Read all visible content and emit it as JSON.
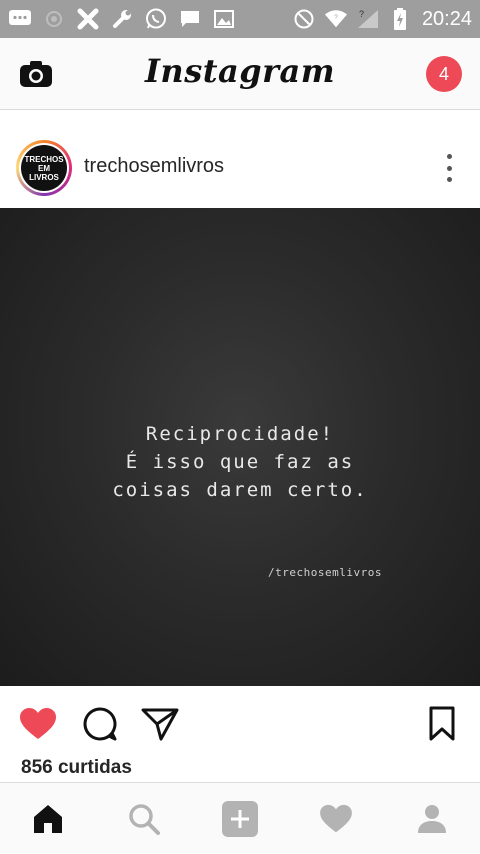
{
  "status_bar": {
    "time": "20:24",
    "icons": [
      "message-icon",
      "circle-icon",
      "puzzle-icon",
      "wrench-icon",
      "whatsapp-icon",
      "chat-icon",
      "image-icon",
      "no-disturb-icon",
      "wifi-icon",
      "signal-icon",
      "battery-icon"
    ]
  },
  "top_bar": {
    "logo": "Instagram",
    "notification_count": "4",
    "camera_icon": "camera-icon"
  },
  "post": {
    "username": "trechosemlivros",
    "avatar_text": [
      "TRECHOS",
      "EM",
      "LIVROS"
    ],
    "image_quote": [
      "Reciprocidade!",
      "É isso que faz as",
      "coisas darem certo."
    ],
    "image_watermark": "/trechosemlivros",
    "likes": "856 curtidas"
  },
  "colors": {
    "accent_red": "#ed4956",
    "status_bar": "#9e9e9e"
  },
  "actions": [
    "heart-filled-icon",
    "comment-icon",
    "share-icon",
    "bookmark-icon"
  ],
  "bottom_nav": [
    "home-icon",
    "search-icon",
    "add-icon",
    "activity-heart-icon",
    "profile-icon"
  ]
}
